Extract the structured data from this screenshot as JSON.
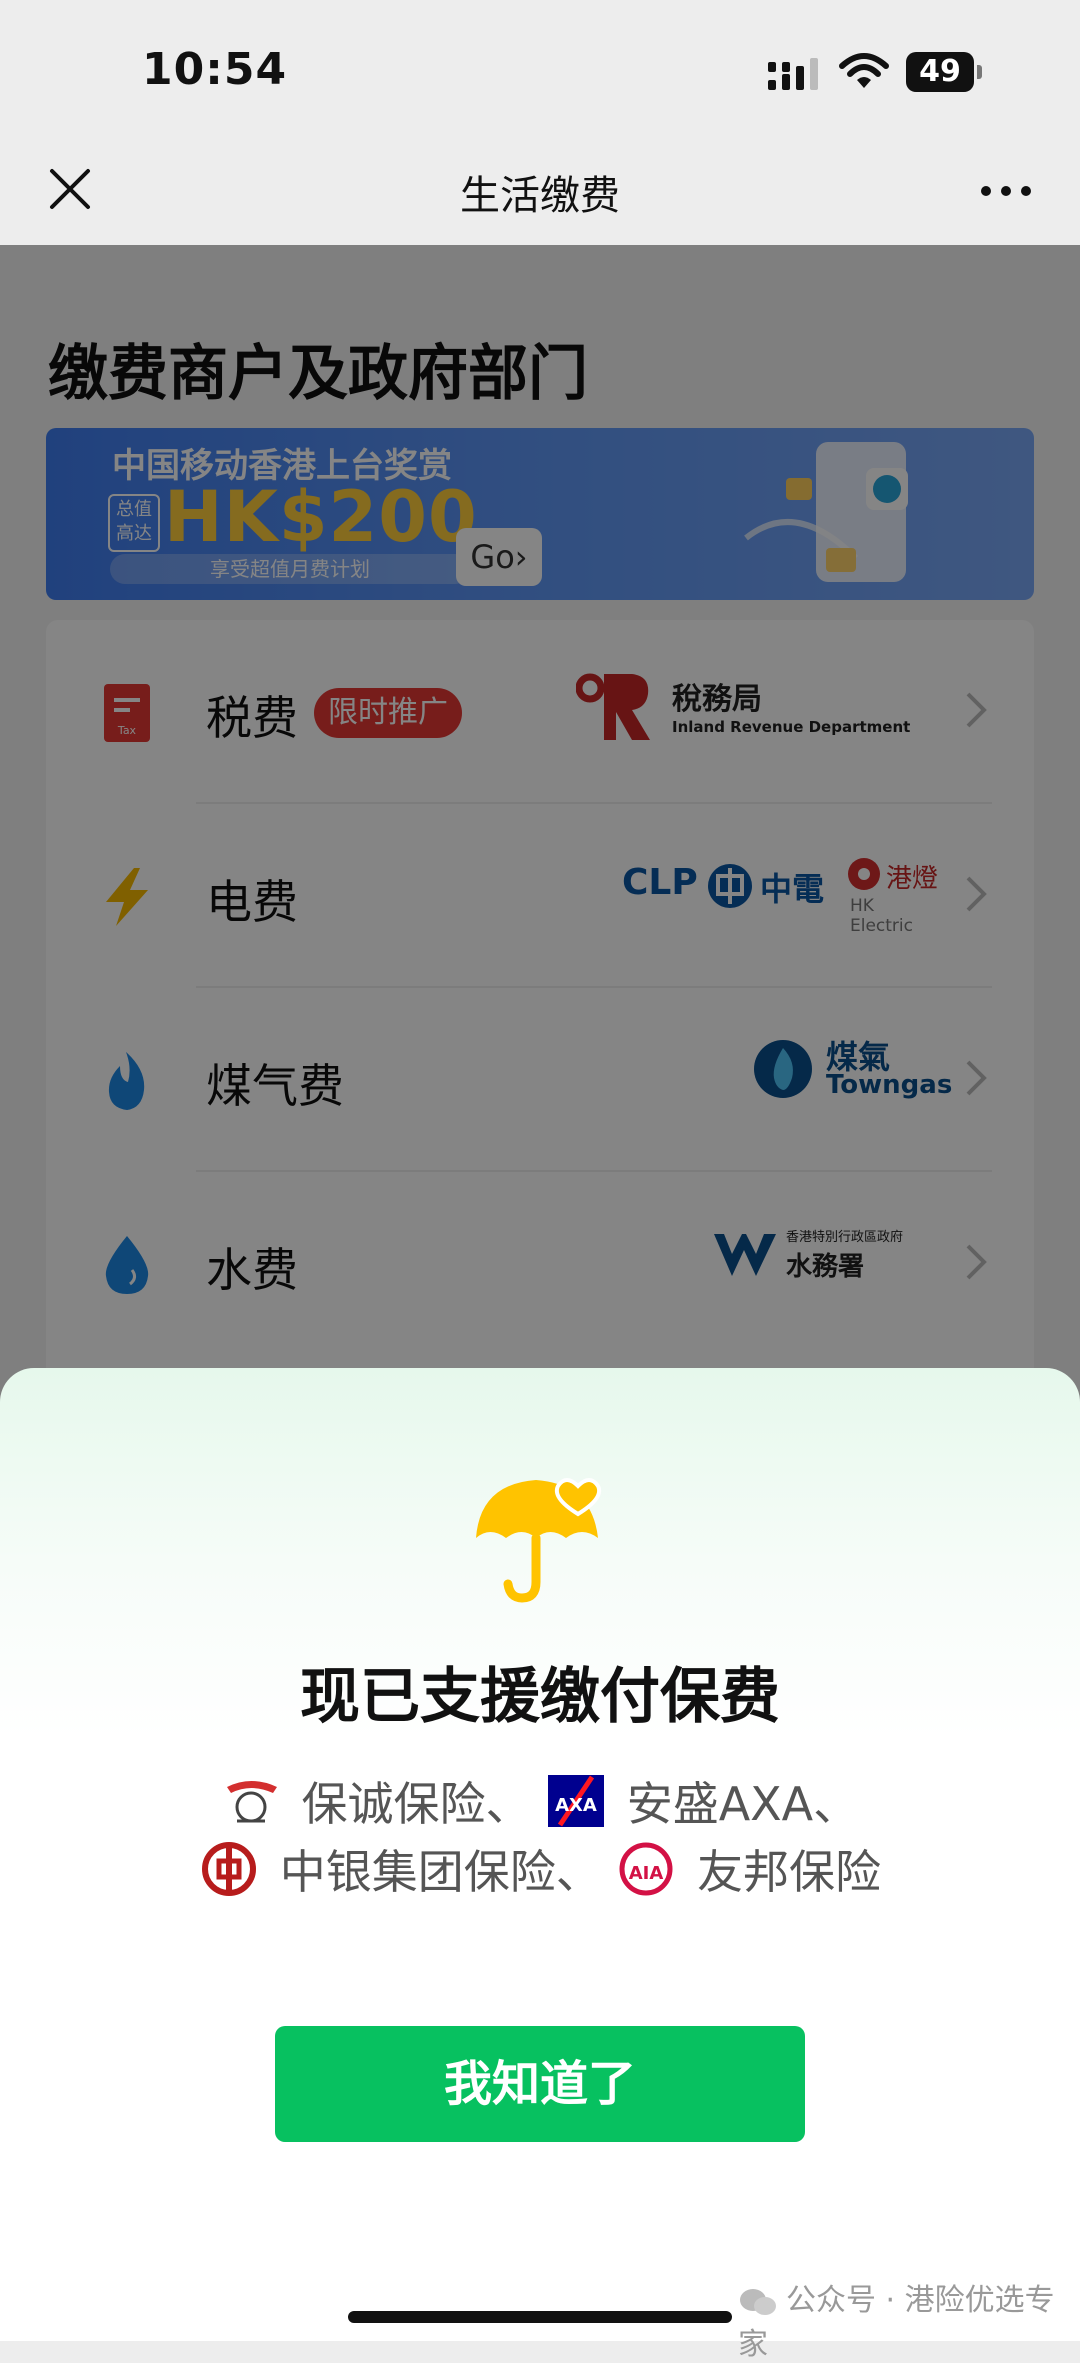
{
  "status_bar": {
    "time": "10:54",
    "battery": "49"
  },
  "nav": {
    "title": "生活缴费"
  },
  "page": {
    "section_title": "缴费商户及政府部门",
    "banner": {
      "title": "中国移动香港上台奖赏",
      "tag": "总值高达",
      "amount": "HK$200",
      "subtitle": "享受超值月费计划",
      "go": "Go"
    },
    "rows": [
      {
        "label": "税费",
        "badge": "限时推广",
        "logo_text": "稅務局",
        "logo_sub": "Inland Revenue Department"
      },
      {
        "label": "电费",
        "logo_text": "CLP",
        "logo_text2": "中電",
        "logo_text3": "港燈",
        "logo_sub": "HK Electric"
      },
      {
        "label": "煤气费",
        "logo_text": "煤氣",
        "logo_sub": "Towngas"
      },
      {
        "label": "水费",
        "logo_text": "水務署",
        "logo_sub": "香港特別行政區政府"
      }
    ]
  },
  "sheet": {
    "title": "现已支援缴付保费",
    "line1": [
      "保诚保险、",
      "安盛AXA、"
    ],
    "line2": [
      "中银集团保险、",
      "友邦保险"
    ],
    "button": "我知道了"
  },
  "watermark": "公众号 · 港险优选专家",
  "colors": {
    "accent": "#07c160",
    "badge": "#e53935",
    "umbrella": "#ffc300"
  }
}
